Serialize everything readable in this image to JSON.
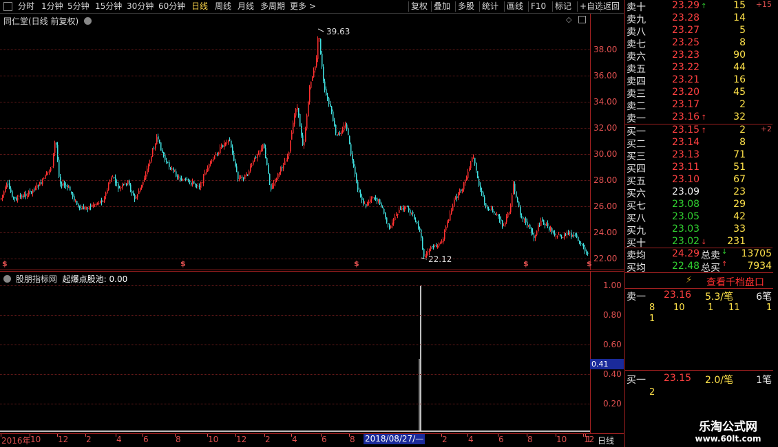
{
  "toolbar": {
    "left_items": [
      "分时",
      "1分钟",
      "5分钟",
      "15分钟",
      "30分钟",
      "60分钟",
      "日线",
      "周线",
      "月线",
      "多周期",
      "更多 >"
    ],
    "active": "日线",
    "right_items": [
      "复权",
      "叠加",
      "多股",
      "统计",
      "画线",
      "F10",
      "标记",
      "+自选",
      "返回"
    ]
  },
  "main_chart": {
    "title": "同仁堂(日线 前复权)",
    "y_ticks": [
      "38.00",
      "36.00",
      "34.00",
      "32.00",
      "30.00",
      "28.00",
      "26.00",
      "24.00",
      "22.00"
    ],
    "max_label": "39.63",
    "min_label": "22.12",
    "marker": "$"
  },
  "indicator": {
    "title": "股朋指标网",
    "line_label": "起爆点股池: 0.00",
    "y_ticks": [
      "1.00",
      "0.80",
      "0.60",
      "0.40",
      "0.20"
    ],
    "cursor_value": "0.41"
  },
  "date_axis": {
    "labels": [
      "2016年",
      "10",
      "12",
      "2",
      "4",
      "6",
      "8",
      "10",
      "12",
      "2",
      "4",
      "6",
      "8",
      "2",
      "2",
      "4",
      "6",
      "8",
      "10",
      "12",
      "1"
    ],
    "highlight": "2018/08/27/—",
    "period": "日线"
  },
  "order_book": {
    "asks": [
      {
        "label": "卖十",
        "price": "23.29",
        "vol": "15",
        "arrow": "up",
        "change": "+15"
      },
      {
        "label": "卖九",
        "price": "23.28",
        "vol": "14"
      },
      {
        "label": "卖八",
        "price": "23.27",
        "vol": "5"
      },
      {
        "label": "卖七",
        "price": "23.25",
        "vol": "8"
      },
      {
        "label": "卖六",
        "price": "23.23",
        "vol": "90"
      },
      {
        "label": "卖五",
        "price": "23.22",
        "vol": "44"
      },
      {
        "label": "卖四",
        "price": "23.21",
        "vol": "16"
      },
      {
        "label": "卖三",
        "price": "23.20",
        "vol": "45"
      },
      {
        "label": "卖二",
        "price": "23.17",
        "vol": "2"
      },
      {
        "label": "卖一",
        "price": "23.16",
        "vol": "32",
        "arrow": "up"
      }
    ],
    "bids": [
      {
        "label": "买一",
        "price": "23.15",
        "vol": "2",
        "arrow": "up",
        "change": "+2"
      },
      {
        "label": "买二",
        "price": "23.14",
        "vol": "8"
      },
      {
        "label": "买三",
        "price": "23.13",
        "vol": "71"
      },
      {
        "label": "买四",
        "price": "23.11",
        "vol": "51"
      },
      {
        "label": "买五",
        "price": "23.10",
        "vol": "67"
      },
      {
        "label": "买六",
        "price": "23.09",
        "vol": "23"
      },
      {
        "label": "买七",
        "price": "23.08",
        "vol": "29"
      },
      {
        "label": "买八",
        "price": "23.05",
        "vol": "42"
      },
      {
        "label": "买九",
        "price": "23.03",
        "vol": "33"
      },
      {
        "label": "买十",
        "price": "23.02",
        "vol": "231",
        "arrow": "down"
      }
    ],
    "avg_sell_label": "卖均",
    "avg_sell": "24.29",
    "total_sell_label": "总卖",
    "total_sell": "13705",
    "avg_buy_label": "买均",
    "avg_buy": "22.48",
    "total_buy_label": "总买",
    "total_buy": "7934",
    "view_1000": "查看千档盘口",
    "sell1_label": "卖一",
    "sell1_price": "23.16",
    "sell1_avg": "5.3/笔",
    "sell1_count": "6笔",
    "sell1_queue": [
      "8",
      "10",
      "1",
      "11",
      "1",
      "1"
    ],
    "buy1_label": "买一",
    "buy1_price": "23.15",
    "buy1_avg": "2.0/笔",
    "buy1_count": "1笔",
    "buy1_queue": [
      "2"
    ]
  },
  "watermark": {
    "name": "乐淘公式网",
    "url": "www.60lt.com"
  },
  "colors": {
    "up": "#ff3030",
    "down": "#40e0e0",
    "grid": "#6a1a1a",
    "border": "#a02020"
  }
}
